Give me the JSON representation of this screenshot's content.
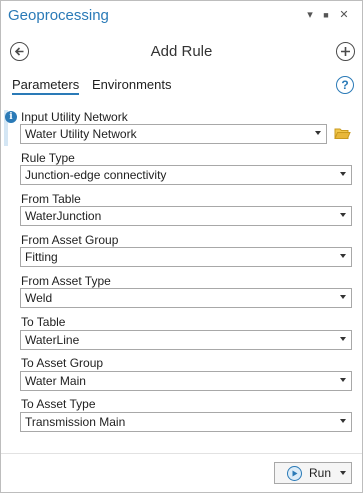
{
  "pane": {
    "title": "Geoprocessing",
    "controls": {
      "options": "▾",
      "pin": "■",
      "close": "✕"
    }
  },
  "header": {
    "title": "Add Rule"
  },
  "tabs": [
    {
      "label": "Parameters",
      "active": true
    },
    {
      "label": "Environments",
      "active": false
    }
  ],
  "params": [
    {
      "label": "Input Utility Network",
      "value": "Water Utility Network"
    },
    {
      "label": "Rule Type",
      "value": "Junction-edge connectivity"
    },
    {
      "label": "From Table",
      "value": "WaterJunction"
    },
    {
      "label": "From Asset Group",
      "value": "Fitting"
    },
    {
      "label": "From Asset Type",
      "value": "Weld"
    },
    {
      "label": "To Table",
      "value": "WaterLine"
    },
    {
      "label": "To Asset Group",
      "value": "Water Main"
    },
    {
      "label": "To Asset Type",
      "value": "Transmission Main"
    }
  ],
  "footer": {
    "run_label": "Run"
  },
  "colors": {
    "accent": "#2a7ab7",
    "folder": "#e8b73a"
  }
}
